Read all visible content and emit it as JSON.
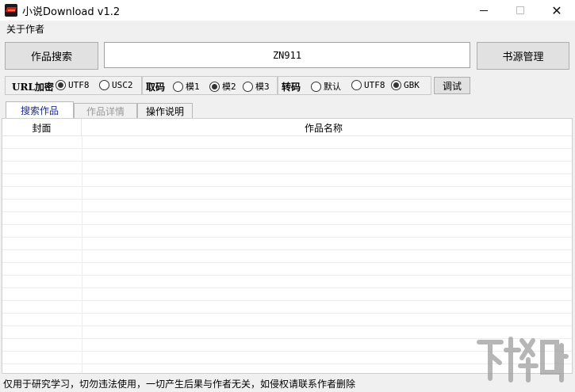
{
  "window": {
    "title": "小说Download v1.2",
    "minimize_glyph": "—",
    "close_glyph": "✕"
  },
  "menu": {
    "about": "关于作者"
  },
  "toolbar": {
    "search_label": "作品搜索",
    "keyword_value": "ZN911",
    "source_label": "书源管理"
  },
  "options": {
    "url_encode": {
      "label": "URL加密",
      "options": [
        "UTF8",
        "USC2"
      ],
      "selected": "UTF8"
    },
    "take": {
      "label": "取码",
      "options": [
        "模1",
        "模2",
        "模3"
      ],
      "selected": "模2"
    },
    "transcode": {
      "label": "转码",
      "options": [
        "默认",
        "UTF8",
        "GBK"
      ],
      "selected": "GBK"
    },
    "debug_label": "调试"
  },
  "tabs": [
    {
      "label": "搜索作品",
      "active": true
    },
    {
      "label": "作品详情",
      "active": false
    },
    {
      "label": "操作说明",
      "active": false
    }
  ],
  "list": {
    "columns": [
      "封面",
      "作品名称"
    ],
    "rows": []
  },
  "status": {
    "text": "仅用于研究学习，切勿违法使用，一切产生后果与作者无关，如侵权请联系作者删除"
  },
  "watermark": {
    "text": "下载吧"
  },
  "colors": {
    "active_tab_text": "#1b2a8f",
    "disabled_tab_text": "#9a9a9a",
    "chrome": "#f0f0f0"
  }
}
